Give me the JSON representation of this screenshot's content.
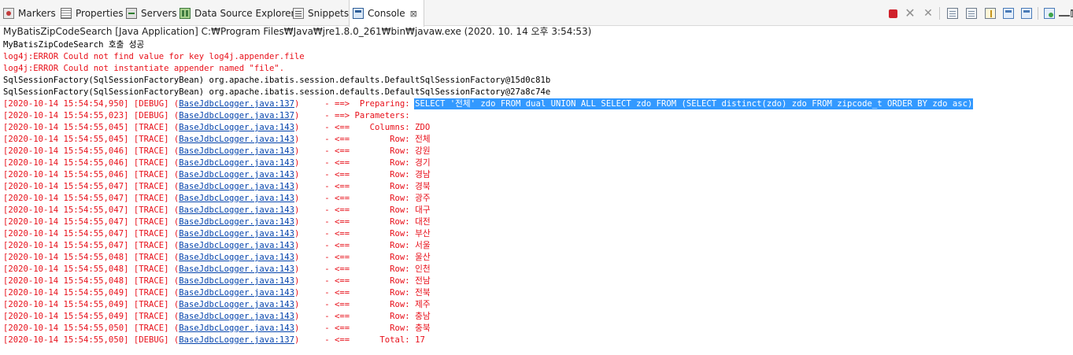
{
  "tabs": [
    {
      "label": "Markers",
      "icon": "markers-icon"
    },
    {
      "label": "Properties",
      "icon": "properties-icon"
    },
    {
      "label": "Servers",
      "icon": "servers-icon"
    },
    {
      "label": "Data Source Explorer",
      "icon": "data-source-explorer-icon"
    },
    {
      "label": "Snippets",
      "icon": "snippets-icon"
    },
    {
      "label": "Console",
      "icon": "console-icon",
      "close": "⊠",
      "active": true
    }
  ],
  "process_label": "MyBatisZipCodeSearch [Java Application] C:₩Program Files₩Java₩jre1.8.0_261₩bin₩javaw.exe  (2020. 10. 14 오후 3:54:53)",
  "colors": {
    "stderr": "#e8101a",
    "stdout": "#000000",
    "link": "#0645ad",
    "selection": "#3399ff",
    "terminate": "#d0212b"
  },
  "console": {
    "plain_lines": [
      "MyBatisZipCodeSearch 호출 성공",
      "log4j:ERROR Could not find value for key log4j.appender.file",
      "log4j:ERROR Could not instantiate appender named \"file\".",
      "SqlSessionFactory(SqlSessionFactoryBean) org.apache.ibatis.session.defaults.DefaultSqlSessionFactory@15d0c81b",
      "SqlSessionFactory(SqlSessionFactoryBean) org.apache.ibatis.session.defaults.DefaultSqlSessionFactory@27a8c74e"
    ],
    "log_lines": [
      {
        "time": "[2020-10-14 15:54:54,950]",
        "level": "[DEBUG]",
        "link": "BaseJdbcLogger.java:137",
        "arrow": "- ==>",
        "label": " Preparing:",
        "value": "SELECT '전체' zdo FROM dual UNION ALL SELECT zdo FROM (SELECT distinct(zdo) zdo FROM zipcode_t ORDER BY zdo asc)"
      },
      {
        "time": "[2020-10-14 15:54:55,023]",
        "level": "[DEBUG]",
        "link": "BaseJdbcLogger.java:137",
        "arrow": "- ==>",
        "label": "Parameters:",
        "value": ""
      },
      {
        "time": "[2020-10-14 15:54:55,045]",
        "level": "[TRACE]",
        "link": "BaseJdbcLogger.java:143",
        "arrow": "- <==",
        "label": "   Columns:",
        "value": "ZDO"
      },
      {
        "time": "[2020-10-14 15:54:55,045]",
        "level": "[TRACE]",
        "link": "BaseJdbcLogger.java:143",
        "arrow": "- <==",
        "label": "       Row:",
        "value": "전체"
      },
      {
        "time": "[2020-10-14 15:54:55,046]",
        "level": "[TRACE]",
        "link": "BaseJdbcLogger.java:143",
        "arrow": "- <==",
        "label": "       Row:",
        "value": "강원"
      },
      {
        "time": "[2020-10-14 15:54:55,046]",
        "level": "[TRACE]",
        "link": "BaseJdbcLogger.java:143",
        "arrow": "- <==",
        "label": "       Row:",
        "value": "경기"
      },
      {
        "time": "[2020-10-14 15:54:55,046]",
        "level": "[TRACE]",
        "link": "BaseJdbcLogger.java:143",
        "arrow": "- <==",
        "label": "       Row:",
        "value": "경남"
      },
      {
        "time": "[2020-10-14 15:54:55,047]",
        "level": "[TRACE]",
        "link": "BaseJdbcLogger.java:143",
        "arrow": "- <==",
        "label": "       Row:",
        "value": "경북"
      },
      {
        "time": "[2020-10-14 15:54:55,047]",
        "level": "[TRACE]",
        "link": "BaseJdbcLogger.java:143",
        "arrow": "- <==",
        "label": "       Row:",
        "value": "광주"
      },
      {
        "time": "[2020-10-14 15:54:55,047]",
        "level": "[TRACE]",
        "link": "BaseJdbcLogger.java:143",
        "arrow": "- <==",
        "label": "       Row:",
        "value": "대구"
      },
      {
        "time": "[2020-10-14 15:54:55,047]",
        "level": "[TRACE]",
        "link": "BaseJdbcLogger.java:143",
        "arrow": "- <==",
        "label": "       Row:",
        "value": "대전"
      },
      {
        "time": "[2020-10-14 15:54:55,047]",
        "level": "[TRACE]",
        "link": "BaseJdbcLogger.java:143",
        "arrow": "- <==",
        "label": "       Row:",
        "value": "부산"
      },
      {
        "time": "[2020-10-14 15:54:55,047]",
        "level": "[TRACE]",
        "link": "BaseJdbcLogger.java:143",
        "arrow": "- <==",
        "label": "       Row:",
        "value": "서울"
      },
      {
        "time": "[2020-10-14 15:54:55,048]",
        "level": "[TRACE]",
        "link": "BaseJdbcLogger.java:143",
        "arrow": "- <==",
        "label": "       Row:",
        "value": "울산"
      },
      {
        "time": "[2020-10-14 15:54:55,048]",
        "level": "[TRACE]",
        "link": "BaseJdbcLogger.java:143",
        "arrow": "- <==",
        "label": "       Row:",
        "value": "인천"
      },
      {
        "time": "[2020-10-14 15:54:55,048]",
        "level": "[TRACE]",
        "link": "BaseJdbcLogger.java:143",
        "arrow": "- <==",
        "label": "       Row:",
        "value": "전남"
      },
      {
        "time": "[2020-10-14 15:54:55,049]",
        "level": "[TRACE]",
        "link": "BaseJdbcLogger.java:143",
        "arrow": "- <==",
        "label": "       Row:",
        "value": "전북"
      },
      {
        "time": "[2020-10-14 15:54:55,049]",
        "level": "[TRACE]",
        "link": "BaseJdbcLogger.java:143",
        "arrow": "- <==",
        "label": "       Row:",
        "value": "제주"
      },
      {
        "time": "[2020-10-14 15:54:55,049]",
        "level": "[TRACE]",
        "link": "BaseJdbcLogger.java:143",
        "arrow": "- <==",
        "label": "       Row:",
        "value": "충남"
      },
      {
        "time": "[2020-10-14 15:54:55,050]",
        "level": "[TRACE]",
        "link": "BaseJdbcLogger.java:143",
        "arrow": "- <==",
        "label": "       Row:",
        "value": "충북"
      },
      {
        "time": "[2020-10-14 15:54:55,050]",
        "level": "[DEBUG]",
        "link": "BaseJdbcLogger.java:137",
        "arrow": "- <==",
        "label": "     Total:",
        "value": "17"
      }
    ]
  }
}
